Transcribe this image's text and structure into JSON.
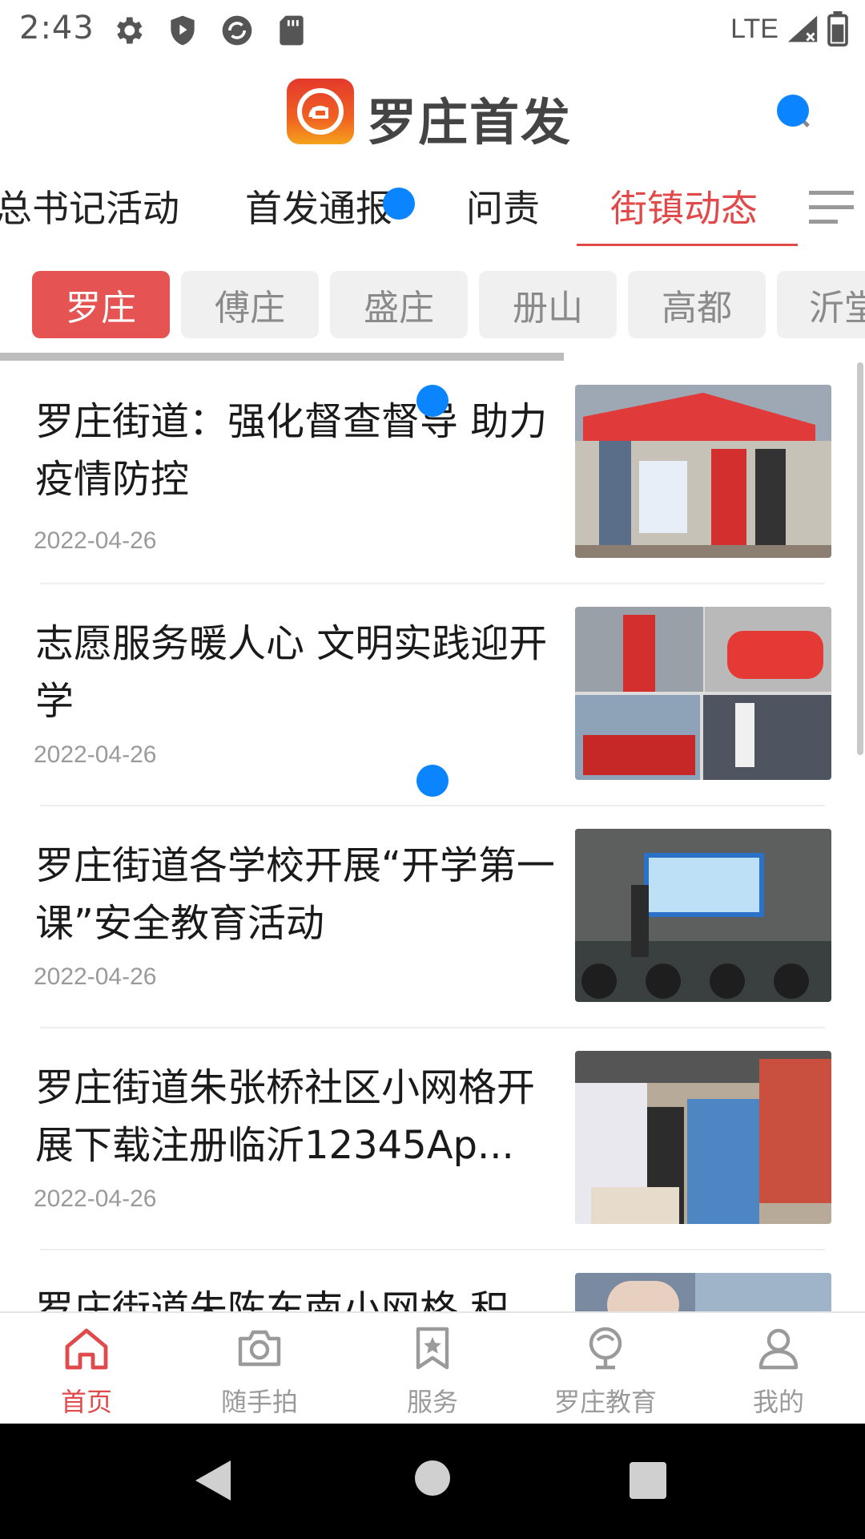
{
  "status_bar": {
    "time": "2:43",
    "network": "LTE",
    "icons": [
      "gear-icon",
      "shield-icon",
      "sync-icon",
      "sd-card-icon",
      "signal-icon",
      "battery-icon"
    ]
  },
  "header": {
    "app_name": "罗庄首发",
    "logo_icon": "logo-icon",
    "search_icon": "search-icon",
    "accent_color": "#e04a4a"
  },
  "category_tabs": [
    {
      "label": "总书记活动",
      "active": false
    },
    {
      "label": "首发通报",
      "active": false
    },
    {
      "label": "问责",
      "active": false
    },
    {
      "label": "街镇动态",
      "active": true
    }
  ],
  "sub_tabs": [
    {
      "label": "罗庄",
      "active": true
    },
    {
      "label": "傅庄",
      "active": false
    },
    {
      "label": "盛庄",
      "active": false
    },
    {
      "label": "册山",
      "active": false
    },
    {
      "label": "高都",
      "active": false
    },
    {
      "label": "沂堂",
      "active": false
    }
  ],
  "articles": [
    {
      "title": "罗庄街道：强化督查督导 助力疫情防控",
      "date": "2022-04-26"
    },
    {
      "title": "志愿服务暖人心 文明实践迎开学",
      "date": "2022-04-26"
    },
    {
      "title": "罗庄街道各学校开展“开学第一课”安全教育活动",
      "date": "2022-04-26"
    },
    {
      "title": "罗庄街道朱张桥社区小网格开展下载注册临沂12345Ap...",
      "date": "2022-04-26"
    },
    {
      "title": "罗庄街道朱陈东南小网格 积",
      "date": ""
    }
  ],
  "bottom_nav": [
    {
      "label": "首页",
      "icon": "home-icon",
      "active": true
    },
    {
      "label": "随手拍",
      "icon": "camera-icon",
      "active": false
    },
    {
      "label": "服务",
      "icon": "bookmark-star-icon",
      "active": false
    },
    {
      "label": "罗庄教育",
      "icon": "education-icon",
      "active": false
    },
    {
      "label": "我的",
      "icon": "user-icon",
      "active": false
    }
  ]
}
